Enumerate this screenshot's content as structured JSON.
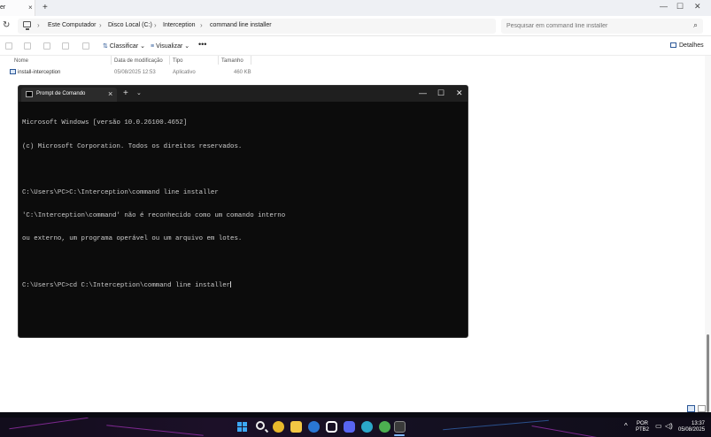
{
  "explorer": {
    "tab_fragment": "er",
    "breadcrumb": [
      "Este Computador",
      "Disco Local (C:)",
      "Interception",
      "command line installer"
    ],
    "search_placeholder": "Pesquisar em command line installer",
    "commands": {
      "sort": "Classificar",
      "view": "Visualizar",
      "more": "•••",
      "details": "Detalhes"
    },
    "columns": [
      "Nome",
      "Data de modificação",
      "Tipo",
      "Tamanho"
    ],
    "files": [
      {
        "name": "install-interception",
        "modified": "05/08/2025 12:53",
        "type": "Aplicativo",
        "size": "460 KB"
      }
    ]
  },
  "cmd": {
    "tab_title": "Prompt de Comando",
    "lines": [
      "Microsoft Windows [versão 10.0.26100.4652]",
      "(c) Microsoft Corporation. Todos os direitos reservados.",
      "",
      "C:\\Users\\PC>C:\\Interception\\command line installer",
      "'C:\\Interception\\command' não é reconhecido como um comando interno",
      "ou externo, um programa operável ou um arquivo em lotes.",
      ""
    ],
    "current_prompt": "C:\\Users\\PC>cd C:\\Interception\\command line installer"
  },
  "taskbar": {
    "apps": [
      {
        "icon": "chrome-icon",
        "color": "#e8b92b"
      },
      {
        "icon": "folder-icon",
        "color": "#f2c744"
      },
      {
        "icon": "app-s-icon",
        "color": "#2a77d4"
      },
      {
        "icon": "app-lock-icon",
        "color": "#ffffff"
      },
      {
        "icon": "discord-icon",
        "color": "#5865f2"
      },
      {
        "icon": "app-c-icon",
        "color": "#2ba7c9"
      },
      {
        "icon": "app-u-icon",
        "color": "#4caf50"
      },
      {
        "icon": "terminal-icon",
        "color": "#3a3a3a"
      }
    ],
    "lang_line1": "POR",
    "lang_line2": "PTB2",
    "time": "13:37",
    "date": "05/08/2025"
  },
  "colors": {
    "accent": "#3da8f5",
    "cmd_bg": "#0c0c0c",
    "cmd_text": "#cccccc"
  }
}
